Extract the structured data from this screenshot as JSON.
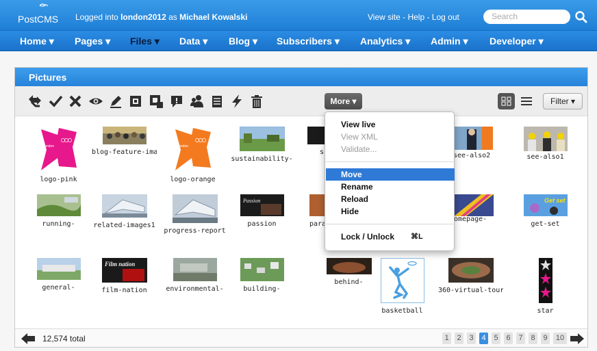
{
  "topbar": {
    "logo_line1": "Post",
    "logo_line2": "CMS",
    "logged_prefix": "Logged into ",
    "site": "london2012",
    "logged_mid": " as ",
    "user": "Michael Kowalski",
    "links": "View site - Help - Log out",
    "search_placeholder": "Search"
  },
  "nav": [
    {
      "label": "Home ▾"
    },
    {
      "label": "Pages ▾"
    },
    {
      "label": "Files ▾",
      "active": true
    },
    {
      "label": "Data ▾"
    },
    {
      "label": "Blog ▾"
    },
    {
      "label": "Subscribers ▾"
    },
    {
      "label": "Analytics ▾"
    },
    {
      "label": "Admin ▾"
    },
    {
      "label": "Developer ▾"
    }
  ],
  "panel": {
    "title": "Pictures",
    "more_label": "More ▾",
    "filter_label": "Filter ▾",
    "tools": [
      "move-icon",
      "check-icon",
      "delete-x-icon",
      "eye-icon",
      "pencil-icon",
      "copy-icon",
      "duplicate-icon",
      "comment-icon",
      "users-icon",
      "notepad-icon",
      "lightning-icon",
      "trash-icon"
    ]
  },
  "pictures": [
    {
      "label": "logo-pink"
    },
    {
      "label": "blog-feature-ima"
    },
    {
      "label": "logo-orange"
    },
    {
      "label": "sustainability-"
    },
    {
      "label": "s"
    },
    {
      "label": "see-also2"
    },
    {
      "label": "see-also1"
    },
    {
      "label": "running-"
    },
    {
      "label": "related-images1"
    },
    {
      "label": "progress-report"
    },
    {
      "label": "passion"
    },
    {
      "label": "para"
    },
    {
      "label": "omepage-"
    },
    {
      "label": "get-set"
    },
    {
      "label": "general-"
    },
    {
      "label": "film-nation"
    },
    {
      "label": "environmental-"
    },
    {
      "label": "building-"
    },
    {
      "label": "behind-"
    },
    {
      "label": "basketball"
    },
    {
      "label": "360-virtual-tour"
    },
    {
      "label": "star"
    }
  ],
  "thumb_texts": {
    "passion": "Passion",
    "film_nation": "Film nation",
    "get_set": "Get set"
  },
  "menu": {
    "items": [
      {
        "label": "View live",
        "state": "normal"
      },
      {
        "label": "View XML",
        "state": "disabled"
      },
      {
        "label": "Validate...",
        "state": "disabled"
      },
      {
        "label": "Move",
        "state": "highlighted"
      },
      {
        "label": "Rename",
        "state": "normal"
      },
      {
        "label": "Reload",
        "state": "normal"
      },
      {
        "label": "Hide",
        "state": "normal"
      },
      {
        "label": "Lock / Unlock",
        "state": "normal",
        "shortcut": "⌘L"
      }
    ]
  },
  "footer": {
    "total": "12,574 total",
    "pages": [
      "1",
      "2",
      "3",
      "4",
      "5",
      "6",
      "7",
      "8",
      "9",
      "10"
    ],
    "current_page": "4"
  },
  "colors": {
    "brand_blue": "#2683da",
    "menu_highlight": "#2e7ad6",
    "london_pink": "#e7188c",
    "london_orange": "#f47a20"
  }
}
